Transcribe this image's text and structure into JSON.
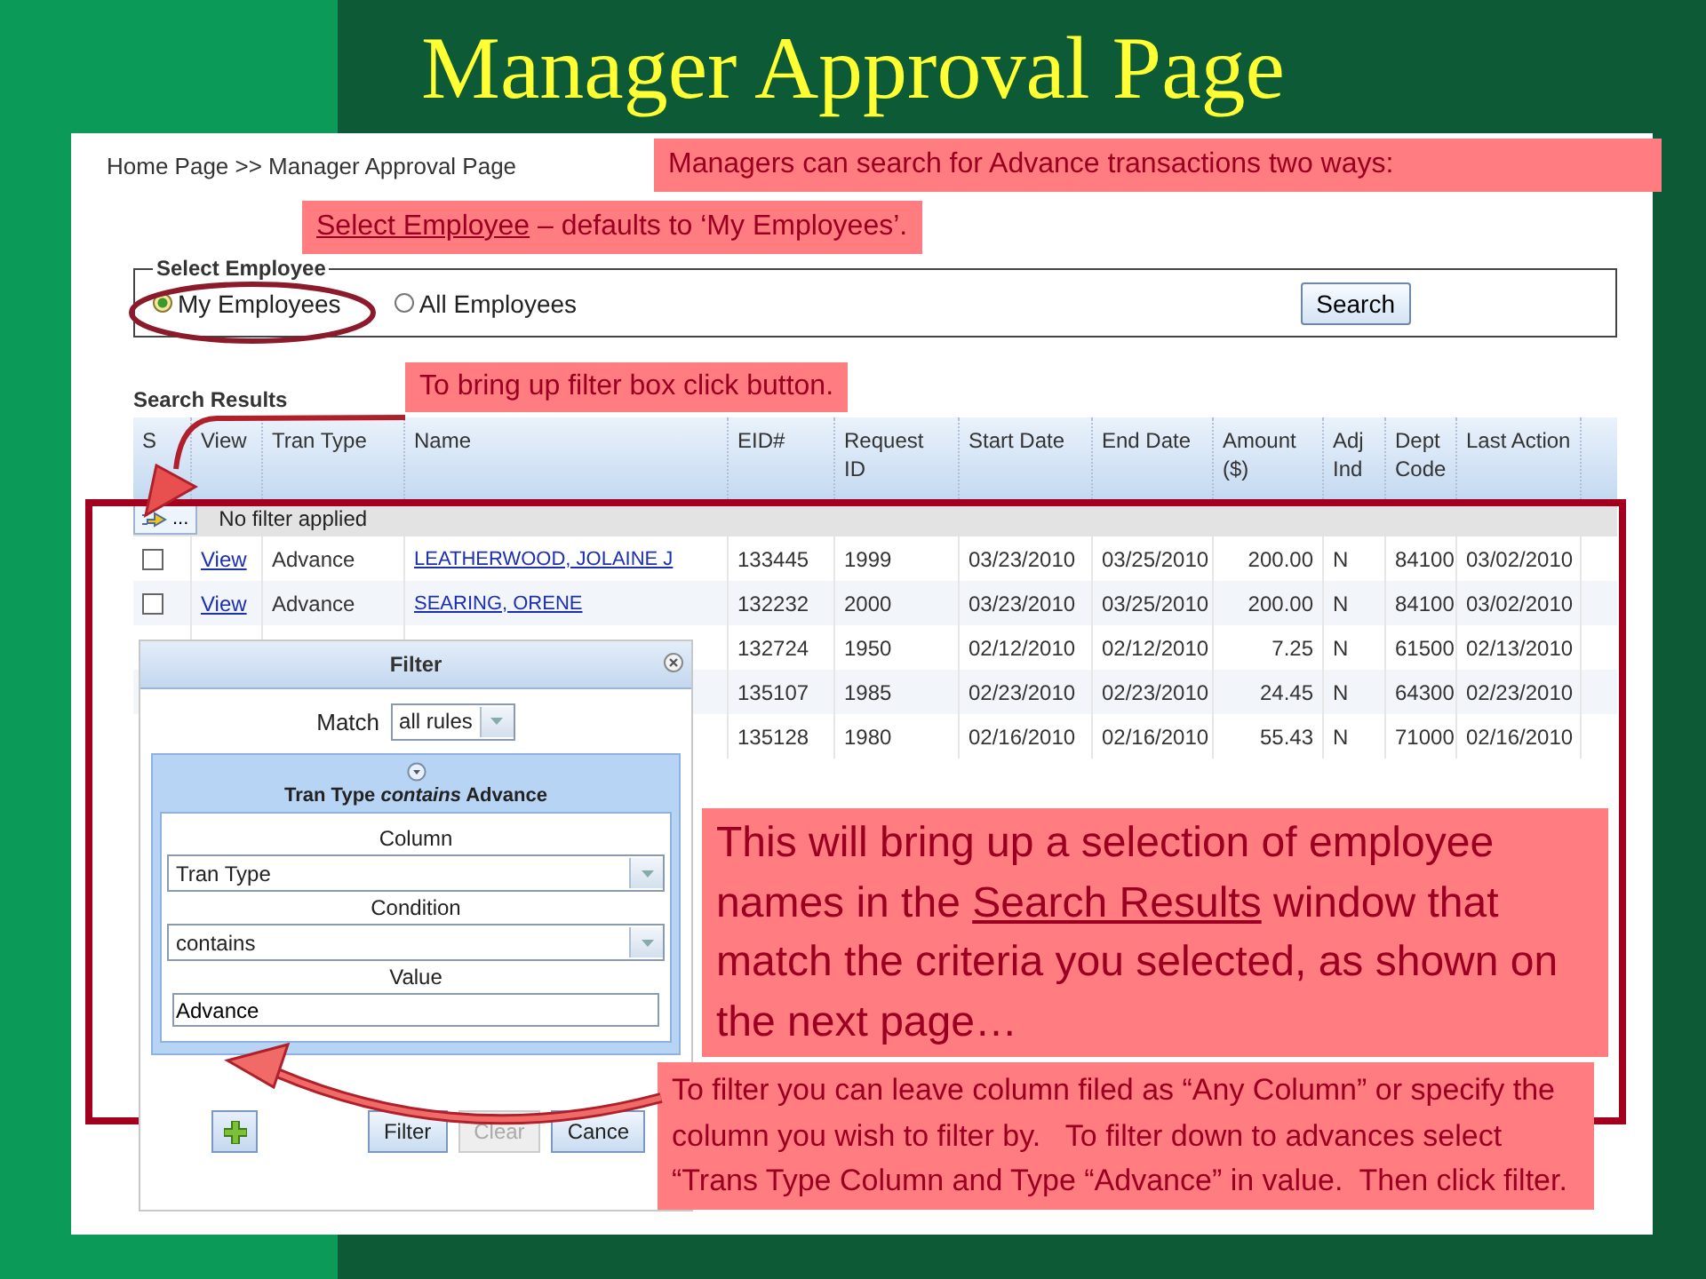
{
  "slide_title": "Manager Approval Page",
  "breadcrumb": "Home Page >> Manager Approval Page",
  "employee_filter": {
    "legend": "Select Employee",
    "options": [
      {
        "label": "My Employees",
        "selected": true
      },
      {
        "label": "All Employees",
        "selected": false
      }
    ],
    "search_button": "Search"
  },
  "search_results": {
    "title": "Search Results",
    "columns": [
      "S",
      "View",
      "Tran Type",
      "Name",
      "EID#",
      "Request ID",
      "Start Date",
      "End Date",
      "Amount ($)",
      "Adj Ind",
      "Dept Code",
      "Last Action"
    ],
    "filter_button": "...",
    "filter_status": "No filter applied",
    "rows": [
      {
        "checked": false,
        "view": "View",
        "tran_type": "Advance",
        "name": "LEATHERWOOD, JOLAINE J",
        "eid": "133445",
        "request_id": "1999",
        "start_date": "03/23/2010",
        "end_date": "03/25/2010",
        "amount": "200.00",
        "adj": "N",
        "dept": "84100",
        "last_action": "03/02/2010"
      },
      {
        "checked": false,
        "view": "View",
        "tran_type": "Advance",
        "name": "SEARING, ORENE",
        "eid": "132232",
        "request_id": "2000",
        "start_date": "03/23/2010",
        "end_date": "03/25/2010",
        "amount": "200.00",
        "adj": "N",
        "dept": "84100",
        "last_action": "03/02/2010"
      },
      {
        "eid": "132724",
        "request_id": "1950",
        "start_date": "02/12/2010",
        "end_date": "02/12/2010",
        "amount": "7.25",
        "adj": "N",
        "dept": "61500",
        "last_action": "02/13/2010"
      },
      {
        "eid": "135107",
        "request_id": "1985",
        "start_date": "02/23/2010",
        "end_date": "02/23/2010",
        "amount": "24.45",
        "adj": "N",
        "dept": "64300",
        "last_action": "02/23/2010"
      },
      {
        "eid": "135128",
        "request_id": "1980",
        "start_date": "02/16/2010",
        "end_date": "02/16/2010",
        "amount": "55.43",
        "adj": "N",
        "dept": "71000",
        "last_action": "02/16/2010"
      }
    ]
  },
  "filter": {
    "title": "Filter",
    "match_label": "Match",
    "match_value": "all rules",
    "rule_title": "Tran Type *contains* Advance",
    "column_label": "Column",
    "column_value": "Tran Type",
    "condition_label": "Condition",
    "condition_value": "contains",
    "value_label": "Value",
    "value": "Advance",
    "buttons": [
      {
        "kind": "add"
      },
      {
        "kind": "text",
        "label": "Filter",
        "disabled": false
      },
      {
        "kind": "text",
        "label": "Clear",
        "disabled": true
      },
      {
        "kind": "text",
        "label": "Cance",
        "disabled": false
      }
    ]
  },
  "callouts": [
    {
      "parts": [
        {
          "text": "Managers can search for Advance transactions two ways:",
          "underline": false
        }
      ]
    },
    {
      "parts": [
        {
          "text": "Select Employee",
          "underline": true
        },
        {
          "text": " – defaults to ‘My Employees’.",
          "underline": false
        }
      ]
    },
    {
      "parts": [
        {
          "text": "To bring up filter box click button.",
          "underline": false
        }
      ]
    },
    {
      "parts": [
        {
          "text": "This will bring up a selection of employee names in the ",
          "underline": false
        },
        {
          "text": "Search Results",
          "underline": true
        },
        {
          "text": " window that match the criteria you selected, as shown on the next page…",
          "underline": false
        }
      ]
    },
    {
      "parts": [
        {
          "text": "To filter you can leave column filed as “Any Column” or specify the column you wish to filter by.   To filter down to advances select “Trans Type Column and Type “Advance” in value.  Then click filter.",
          "underline": false
        }
      ]
    }
  ]
}
